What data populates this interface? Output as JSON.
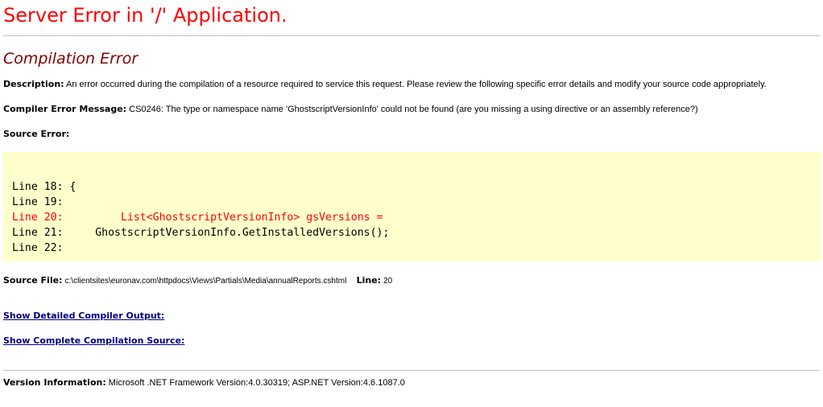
{
  "page": {
    "title": "Server Error in '/' Application.",
    "section_title": "Compilation Error"
  },
  "description": {
    "label": "Description:",
    "text": "An error occurred during the compilation of a resource required to service this request. Please review the following specific error details and modify your source code appropriately."
  },
  "compiler_message": {
    "label": "Compiler Error Message:",
    "text": "CS0246: The type or namespace name 'GhostscriptVersionInfo' could not be found (are you missing a using directive or an assembly reference?)"
  },
  "source_error": {
    "label": "Source Error:",
    "lines": [
      {
        "text": "Line 18: {",
        "highlighted": false
      },
      {
        "text": "Line 19: ",
        "highlighted": false
      },
      {
        "text": "Line 20:         List<GhostscriptVersionInfo> gsVersions =",
        "highlighted": true
      },
      {
        "text": "Line 21:     GhostscriptVersionInfo.GetInstalledVersions();",
        "highlighted": false
      },
      {
        "text": "Line 22: ",
        "highlighted": false
      }
    ]
  },
  "source_file": {
    "label": "Source File:",
    "path": "c:\\clientsites\\euronav.com\\httpdocs\\Views\\Partials\\Media\\annualReports.cshtml",
    "line_label": "Line:",
    "line_value": "20"
  },
  "links": {
    "detailed_output": "Show Detailed Compiler Output:",
    "complete_source": "Show Complete Compilation Source:"
  },
  "version": {
    "label": "Version Information:",
    "text": "Microsoft .NET Framework Version:4.0.30319; ASP.NET Version:4.6.1087.0"
  },
  "colors": {
    "title": "#ff0000",
    "section_title": "#800000",
    "code_background": "#ffffcc",
    "code_error": "#ff0000",
    "link": "#000080",
    "rule": "#c0c0c0"
  }
}
